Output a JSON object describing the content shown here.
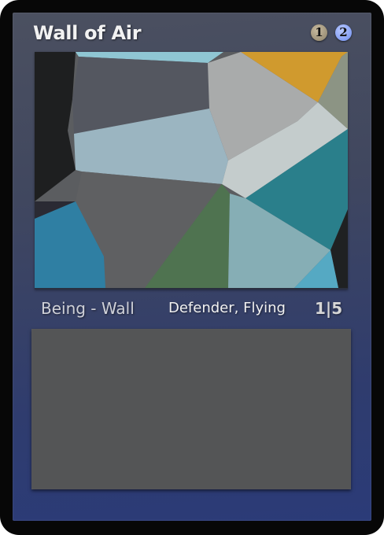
{
  "card": {
    "name": "Wall of Air",
    "mana_cost": {
      "generic": "1",
      "blue": "2"
    },
    "type_line": "Being - Wall",
    "keywords": "Defender, Flying",
    "power_toughness": "1|5",
    "rules_text": ""
  },
  "colors": {
    "frame": "#3a4363",
    "text_box": "#545556",
    "mana_generic": "#a89d82",
    "mana_blue": "#8aa2f7"
  }
}
